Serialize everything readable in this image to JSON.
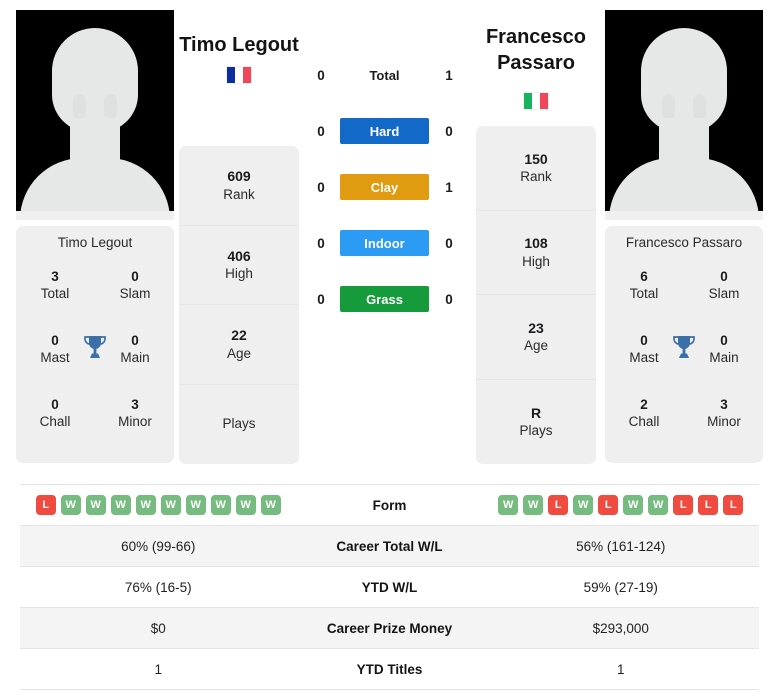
{
  "players": {
    "left": {
      "name": "Timo Legout",
      "flag_name": "france-flag",
      "flag_colors": [
        "#0b2ea0",
        "#ffffff",
        "#f0465a"
      ],
      "summary_name": "Timo Legout",
      "titles": {
        "total_value": "3",
        "total_label": "Total",
        "slam_value": "0",
        "slam_label": "Slam",
        "mast_value": "0",
        "mast_label": "Mast",
        "main_value": "0",
        "main_label": "Main",
        "chall_value": "0",
        "chall_label": "Chall",
        "minor_value": "3",
        "minor_label": "Minor"
      },
      "rank_card": [
        {
          "value": "609",
          "label": "Rank"
        },
        {
          "value": "406",
          "label": "High"
        },
        {
          "value": "22",
          "label": "Age"
        },
        {
          "value": "",
          "label": "Plays"
        }
      ],
      "form": [
        "L",
        "W",
        "W",
        "W",
        "W",
        "W",
        "W",
        "W",
        "W",
        "W"
      ],
      "career_total_wl": "60% (99-66)",
      "ytd_wl": "76% (16-5)",
      "career_prize_money": "$0",
      "ytd_titles": "1"
    },
    "right": {
      "name": "Francesco Passaro",
      "flag_name": "italy-flag",
      "flag_colors": [
        "#18b361",
        "#ffffff",
        "#f0465a"
      ],
      "summary_name": "Francesco Passaro",
      "titles": {
        "total_value": "6",
        "total_label": "Total",
        "slam_value": "0",
        "slam_label": "Slam",
        "mast_value": "0",
        "mast_label": "Mast",
        "main_value": "0",
        "main_label": "Main",
        "chall_value": "2",
        "chall_label": "Chall",
        "minor_value": "3",
        "minor_label": "Minor"
      },
      "rank_card": [
        {
          "value": "150",
          "label": "Rank"
        },
        {
          "value": "108",
          "label": "High"
        },
        {
          "value": "23",
          "label": "Age"
        },
        {
          "value": "R",
          "label": "Plays"
        }
      ],
      "form": [
        "W",
        "W",
        "L",
        "W",
        "L",
        "W",
        "W",
        "L",
        "L",
        "L"
      ],
      "career_total_wl": "56% (161-124)",
      "ytd_wl": "59% (27-19)",
      "career_prize_money": "$293,000",
      "ytd_titles": "1"
    }
  },
  "head_to_head": [
    {
      "label": "Total",
      "left": "0",
      "right": "1",
      "color": ""
    },
    {
      "label": "Hard",
      "left": "0",
      "right": "0",
      "color": "#1269c7"
    },
    {
      "label": "Clay",
      "left": "0",
      "right": "1",
      "color": "#e09b10"
    },
    {
      "label": "Indoor",
      "left": "0",
      "right": "0",
      "color": "#2b9bf4"
    },
    {
      "label": "Grass",
      "left": "0",
      "right": "0",
      "color": "#159a3c"
    }
  ],
  "table": {
    "form_label": "Form",
    "career_total_wl_label": "Career Total W/L",
    "ytd_wl_label": "YTD W/L",
    "career_prize_money_label": "Career Prize Money",
    "ytd_titles_label": "YTD Titles"
  },
  "colors": {
    "win_badge": "#76bb7f",
    "loss_badge": "#ef4b3e",
    "trophy": "#3b6fa8",
    "card_bg": "#efeff0",
    "row_alt_bg": "#f4f4f5"
  }
}
